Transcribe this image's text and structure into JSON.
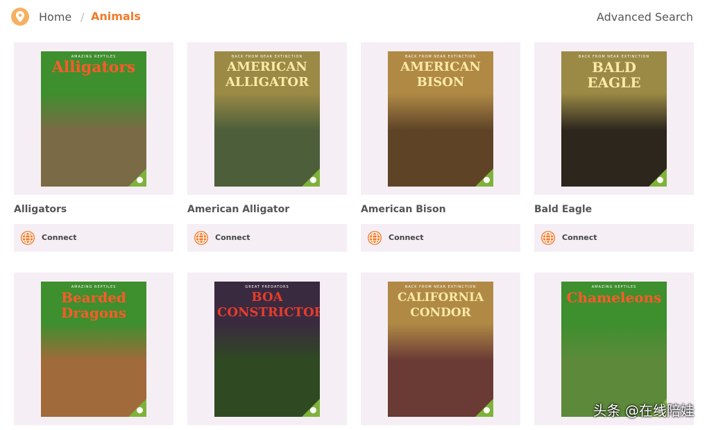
{
  "breadcrumb": {
    "home": "Home",
    "separator": "/",
    "current": "Animals"
  },
  "header": {
    "advanced_search": "Advanced Search"
  },
  "colors": {
    "accent": "#f07b2a",
    "card_bg": "#f5eef5",
    "pin": "#f7b061"
  },
  "books": [
    {
      "title": "Alligators",
      "connect": "Connect",
      "cover_title": "Alligators",
      "cover_series": "AMAZING REPTILES",
      "band": "#3e8f2e",
      "pic": "#7a6a45",
      "text_color": "#ff5a2a",
      "font_size": 22
    },
    {
      "title": "American Alligator",
      "connect": "Connect",
      "cover_title": "AMERICAN ALLIGATOR",
      "cover_series": "BACK FROM NEAR EXTINCTION",
      "band": "#9a8a45",
      "pic": "#4d5e3a",
      "text_color": "#fbe9a8",
      "font_size": 18
    },
    {
      "title": "American Bison",
      "connect": "Connect",
      "cover_title": "AMERICAN BISON",
      "cover_series": "BACK FROM NEAR EXTINCTION",
      "band": "#b08a45",
      "pic": "#5e4327",
      "text_color": "#fbe9a8",
      "font_size": 18
    },
    {
      "title": "Bald Eagle",
      "connect": "Connect",
      "cover_title": "BALD EAGLE",
      "cover_series": "BACK FROM NEAR EXTINCTION",
      "band": "#9a8a45",
      "pic": "#2d261d",
      "text_color": "#fbe9a8",
      "font_size": 20
    },
    {
      "title": "",
      "connect": "",
      "cover_title": "Bearded Dragons",
      "cover_series": "AMAZING REPTILES",
      "band": "#3e8f2e",
      "pic": "#a06a3a",
      "text_color": "#ff5a2a",
      "font_size": 20
    },
    {
      "title": "",
      "connect": "",
      "cover_title": "BOA CONSTRICTOR",
      "cover_series": "GREAT PREDATORS",
      "band": "#3a2a40",
      "pic": "#2f4a22",
      "text_color": "#e83c2a",
      "font_size": 18
    },
    {
      "title": "",
      "connect": "",
      "cover_title": "CALIFORNIA CONDOR",
      "cover_series": "BACK FROM NEAR EXTINCTION",
      "band": "#b08a45",
      "pic": "#6a3a35",
      "text_color": "#fbe9a8",
      "font_size": 17
    },
    {
      "title": "",
      "connect": "",
      "cover_title": "Chameleons",
      "cover_series": "AMAZING REPTILES",
      "band": "#3e8f2e",
      "pic": "#5d8a3a",
      "text_color": "#ff5a2a",
      "font_size": 20
    }
  ],
  "watermark": "头条 @在线陪娃"
}
